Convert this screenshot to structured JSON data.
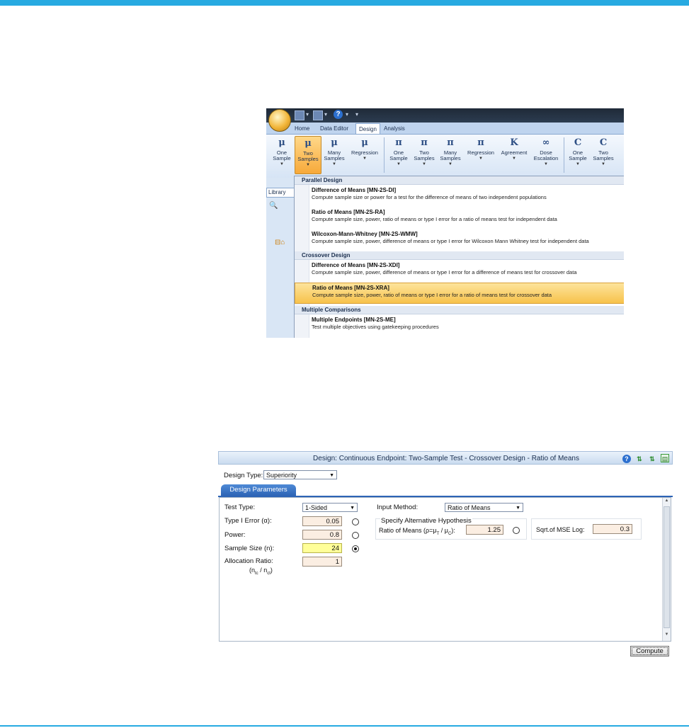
{
  "colors": {
    "accent": "#27aae1",
    "highlight": "#f7c24b",
    "tab_blue": "#2d64b6"
  },
  "ribbon": {
    "tabs": [
      "Home",
      "Data Editor",
      "Design",
      "Analysis"
    ],
    "active_tab": "Design",
    "buttons": [
      {
        "icon": "μ",
        "label1": "One",
        "label2": "Sample"
      },
      {
        "icon": "μ",
        "label1": "Two",
        "label2": "Samples"
      },
      {
        "icon": "μ",
        "label1": "Many",
        "label2": "Samples"
      },
      {
        "icon": "μ",
        "label1": "Regression",
        "label2": ""
      },
      {
        "icon": "π",
        "label1": "One",
        "label2": "Sample"
      },
      {
        "icon": "π",
        "label1": "Two",
        "label2": "Samples"
      },
      {
        "icon": "π",
        "label1": "Many",
        "label2": "Samples"
      },
      {
        "icon": "π",
        "label1": "Regression",
        "label2": ""
      },
      {
        "icon": "K",
        "label1": "Agreement",
        "label2": ""
      },
      {
        "icon": "∞",
        "label1": "Dose",
        "label2": "Escalation"
      },
      {
        "icon": "C",
        "label1": "One",
        "label2": "Sample"
      },
      {
        "icon": "C",
        "label1": "Two",
        "label2": "Samples"
      }
    ],
    "library_tab": "Library"
  },
  "menu": {
    "parallel_header": "Parallel Design",
    "crossover_header": "Crossover Design",
    "multiple_header": "Multiple Comparisons",
    "items": [
      {
        "title": "Difference of Means [MN-2S-DI]",
        "desc": "Compute sample size or power for a test for the difference of means of two independent populations"
      },
      {
        "title": "Ratio of Means [MN-2S-RA]",
        "desc": "Compute sample size, power, ratio of means or type I error for a ratio of means test for independent data"
      },
      {
        "title": "Wilcoxon-Mann-Whitney [MN-2S-WMW]",
        "desc": "Compute sample size, power, difference of means or type I error for Wilcoxon Mann Whitney test for independent data"
      },
      {
        "title": "Difference of Means [MN-2S-XDI]",
        "desc": "Compute sample size, power, difference of means or type I error for a difference of means test for crossover data"
      },
      {
        "title": "Ratio of Means [MN-2S-XRA]",
        "desc": "Compute sample size, power, ratio of means or type I error for a ratio of means test for crossover data"
      },
      {
        "title": "Multiple Endpoints [MN-2S-ME]",
        "desc": "Test multiple objectives using gatekeeping procedures"
      }
    ]
  },
  "dialog": {
    "title": "Design: Continuous Endpoint: Two-Sample Test - Crossover Design - Ratio of Means",
    "design_type_label": "Design Type:",
    "design_type_value": "Superiority",
    "tab_label": "Design Parameters",
    "test_type_label": "Test Type:",
    "test_type_value": "1-Sided",
    "type1_label": "Type I Error (α):",
    "type1_value": "0.05",
    "power_label": "Power:",
    "power_value": "0.8",
    "sample_size_label": "Sample Size (n):",
    "sample_size_value": "24",
    "alloc_label": "Allocation Ratio:",
    "alloc_sub": "(n",
    "alloc_value": "1",
    "input_method_label": "Input Method:",
    "input_method_value": "Ratio of Means",
    "specify_alt_label": "Specify Alternative Hypothesis",
    "ratio_label": "Ratio of Means (ρ=μ",
    "ratio_value": "1.25",
    "sqrt_mse_label": "Sqrt.of MSE Log:",
    "sqrt_mse_value": "0.3",
    "compute_label": "Compute"
  }
}
